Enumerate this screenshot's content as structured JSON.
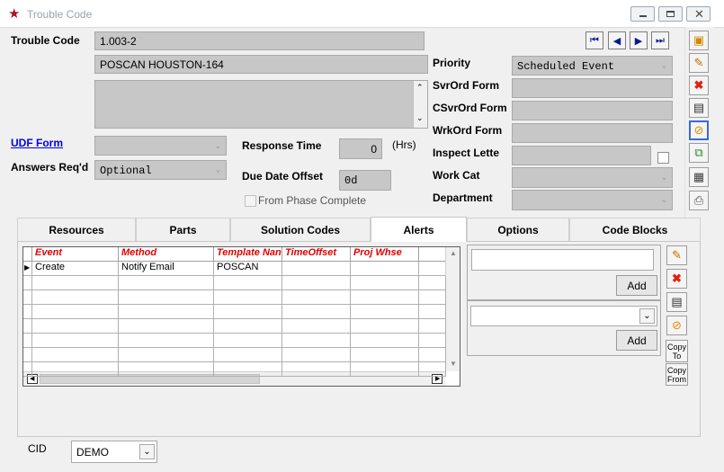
{
  "window": {
    "title": "Trouble Code"
  },
  "header": {
    "trouble_code_label": "Trouble Code",
    "trouble_code_value": "1.003-2",
    "description_value": "POSCAN HOUSTON-164",
    "notes_value": "",
    "udf_form_label": "UDF Form",
    "udf_form_value": "",
    "answers_req_label": "Answers Req'd",
    "answers_req_value": "Optional",
    "response_time_label": "Response Time",
    "response_time_value": "0",
    "response_time_unit": "(Hrs)",
    "due_date_offset_label": "Due Date Offset",
    "due_date_offset_value": "0d",
    "from_phase_label": "From Phase Complete",
    "priority_label": "Priority",
    "priority_value": "Scheduled Event",
    "svrord_form_label": "SvrOrd Form",
    "csvrord_form_label": "CSvrOrd Form",
    "wrkord_form_label": "WrkOrd Form",
    "inspect_letter_label": "Inspect Lette",
    "work_cat_label": "Work Cat",
    "department_label": "Department"
  },
  "tabs": [
    {
      "label": "Resources"
    },
    {
      "label": "Parts"
    },
    {
      "label": "Solution Codes"
    },
    {
      "label": "Alerts",
      "active": true
    },
    {
      "label": "Options"
    },
    {
      "label": "Code Blocks"
    }
  ],
  "alerts": {
    "columns": [
      "Event",
      "Method",
      "Template Nan",
      "TimeOffset",
      "Proj Whse"
    ],
    "rows": [
      [
        "Create",
        "Notify Email",
        "POSCAN",
        "",
        ""
      ]
    ],
    "add_label_1": "Add",
    "add_label_2": "Add",
    "copy_to_label": "Copy To",
    "copy_from_label": "Copy From"
  },
  "footer": {
    "cid_label": "CID",
    "cid_value": "DEMO"
  },
  "colors": {
    "field_gray": "#c7c7c7",
    "header_red": "#e00000",
    "nav_blue": "#0a1a8a"
  }
}
